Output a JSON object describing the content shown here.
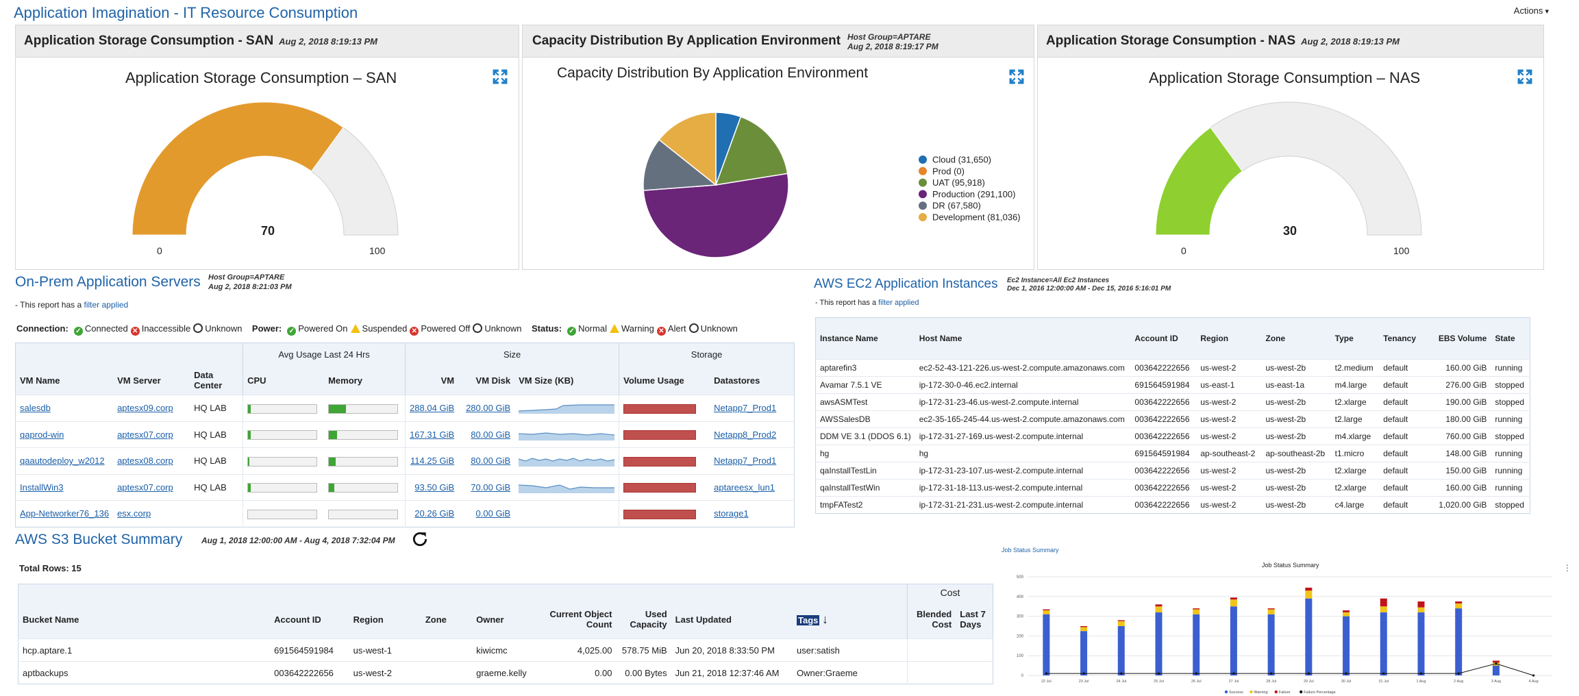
{
  "app": {
    "title": "Application Imagination - IT Resource Consumption",
    "actions_label": "Actions"
  },
  "panels": {
    "san": {
      "header": "Application Storage Consumption - SAN",
      "date": "Aug 2, 2018 8:19:13 PM",
      "chart_title": "Application Storage Consumption – SAN",
      "value": "70",
      "min": "0",
      "max": "100"
    },
    "cap": {
      "header": "Capacity Distribution By Application Environment",
      "meta1": "Host Group=APTARE",
      "meta2": "Aug 2, 2018 8:19:17 PM",
      "chart_title": "Capacity Distribution By Application Environment"
    },
    "nas": {
      "header": "Application Storage Consumption - NAS",
      "date": "Aug 2, 2018 8:19:13 PM",
      "chart_title": "Application Storage Consumption – NAS",
      "value": "30",
      "min": "0",
      "max": "100"
    }
  },
  "chart_data": [
    {
      "type": "gauge",
      "title": "Application Storage Consumption – SAN",
      "value": 70,
      "min": 0,
      "max": 100,
      "color": "#e39a2d"
    },
    {
      "type": "pie",
      "title": "Capacity Distribution By Application Environment",
      "categories": [
        "Cloud",
        "Prod",
        "UAT",
        "Production",
        "DR",
        "Development"
      ],
      "values": [
        31650,
        0,
        95918,
        291100,
        67580,
        81036
      ],
      "colors": [
        "#1f6fb2",
        "#e8852a",
        "#6b8e3a",
        "#6a2478",
        "#65707f",
        "#e6ad45"
      ],
      "legend_labels": [
        "Cloud (31,650)",
        "Prod (0)",
        "UAT (95,918)",
        "Production (291,100)",
        "DR (67,580)",
        "Development (81,036)"
      ],
      "legend": "right"
    },
    {
      "type": "gauge",
      "title": "Application Storage Consumption – NAS",
      "value": 30,
      "min": 0,
      "max": 100,
      "color": "#8fcf2f"
    },
    {
      "type": "bar",
      "title": "Job Status Summary",
      "categories": [
        "22 Jul",
        "23 Jul",
        "24 Jul",
        "25 Jul",
        "26 Jul",
        "27 Jul",
        "28 Jul",
        "29 Jul",
        "30 Jul",
        "31 Jul",
        "1 Aug",
        "2 Aug",
        "3 Aug",
        "4 Aug"
      ],
      "series": [
        {
          "name": "Success",
          "values": [
            310,
            225,
            250,
            320,
            310,
            350,
            310,
            390,
            300,
            320,
            320,
            340,
            50,
            0
          ]
        },
        {
          "name": "Warning",
          "values": [
            20,
            20,
            25,
            30,
            25,
            35,
            25,
            40,
            20,
            30,
            25,
            25,
            15,
            0
          ]
        },
        {
          "name": "Failure",
          "values": [
            5,
            5,
            5,
            10,
            5,
            10,
            5,
            15,
            10,
            40,
            30,
            10,
            10,
            0
          ]
        },
        {
          "name": "Failure Percentage",
          "values": [
            2,
            2,
            2,
            2,
            2,
            2,
            2,
            2,
            2,
            2,
            2,
            2,
            12,
            0
          ]
        }
      ],
      "colors": [
        "#3b5fd0",
        "#f0c419",
        "#c0141c",
        "#111111"
      ],
      "ylim": [
        0,
        500
      ],
      "legend": "bottom"
    }
  ],
  "onprem": {
    "title": "On-Prem Application Servers",
    "meta1": "Host Group=APTARE",
    "meta2": "Aug 2, 2018 8:21:03 PM",
    "note_prefix": "- This report has a ",
    "note_link": "filter applied",
    "legend": {
      "connection_label": "Connection:",
      "connected": "Connected",
      "inaccessible": "Inaccessible",
      "unknown": "Unknown",
      "power_label": "Power:",
      "powered_on": "Powered On",
      "suspended": "Suspended",
      "powered_off": "Powered Off",
      "unknown2": "Unknown",
      "status_label": "Status:",
      "normal": "Normal",
      "warning": "Warning",
      "alert": "Alert",
      "unknown3": "Unknown"
    },
    "groups": {
      "avg": "Avg Usage Last 24 Hrs",
      "size": "Size",
      "storage": "Storage"
    },
    "columns": {
      "vm_name": "VM Name",
      "vm_server": "VM Server",
      "dc": "Data Center",
      "cpu": "CPU",
      "mem": "Memory",
      "vm": "VM",
      "vm_disk": "VM Disk",
      "vm_size": "VM Size (KB)",
      "vol": "Volume Usage",
      "ds": "Datastores"
    },
    "rows": [
      {
        "vm_name": "salesdb",
        "server": "aptesx09.corp",
        "dc": "HQ LAB",
        "cpu": 4,
        "mem": 25,
        "vm": "288.04 GiB",
        "disk": "280.00 GiB",
        "ds": "Netapp7_Prod1"
      },
      {
        "vm_name": "qaprod-win",
        "server": "aptesx07.corp",
        "dc": "HQ LAB",
        "cpu": 4,
        "mem": 12,
        "vm": "167.31 GiB",
        "disk": "80.00 GiB",
        "ds": "Netapp8_Prod2"
      },
      {
        "vm_name": "qaautodeploy_w2012",
        "server": "aptesx08.corp",
        "dc": "HQ LAB",
        "cpu": 2,
        "mem": 10,
        "vm": "114.25 GiB",
        "disk": "80.00 GiB",
        "ds": "Netapp7_Prod1"
      },
      {
        "vm_name": "InstallWin3",
        "server": "aptesx07.corp",
        "dc": "HQ LAB",
        "cpu": 4,
        "mem": 8,
        "vm": "93.50 GiB",
        "disk": "70.00 GiB",
        "ds": "aptareesx_lun1"
      },
      {
        "vm_name": "App-Networker76_136",
        "server": "esx.corp",
        "dc": "",
        "cpu": 0,
        "mem": 0,
        "vm": "20.26 GiB",
        "disk": "0.00 GiB",
        "ds": "storage1"
      }
    ]
  },
  "ec2": {
    "title": "AWS EC2 Application Instances",
    "meta1": "Ec2 Instance=All Ec2 Instances",
    "meta2": "Dec 1, 2016 12:00:00 AM - Dec 15, 2016 5:16:01 PM",
    "note_prefix": "- This report has a ",
    "note_link": "filter applied",
    "columns": [
      "Instance Name",
      "Host Name",
      "Account ID",
      "Region",
      "Zone",
      "Type",
      "Tenancy",
      "EBS Volume",
      "State"
    ],
    "rows": [
      [
        "aptarefin3",
        "ec2-52-43-121-226.us-west-2.compute.amazonaws.com",
        "003642222656",
        "us-west-2",
        "us-west-2b",
        "t2.medium",
        "default",
        "160.00 GiB",
        "running"
      ],
      [
        "Avamar 7.5.1 VE",
        "ip-172-30-0-46.ec2.internal",
        "691564591984",
        "us-east-1",
        "us-east-1a",
        "m4.large",
        "default",
        "276.00 GiB",
        "stopped"
      ],
      [
        "awsASMTest",
        "ip-172-31-23-46.us-west-2.compute.internal",
        "003642222656",
        "us-west-2",
        "us-west-2b",
        "t2.xlarge",
        "default",
        "190.00 GiB",
        "stopped"
      ],
      [
        "AWSSalesDB",
        "ec2-35-165-245-44.us-west-2.compute.amazonaws.com",
        "003642222656",
        "us-west-2",
        "us-west-2b",
        "t2.large",
        "default",
        "180.00 GiB",
        "running"
      ],
      [
        "DDM VE 3.1 (DDOS 6.1)",
        "ip-172-31-27-169.us-west-2.compute.internal",
        "003642222656",
        "us-west-2",
        "us-west-2b",
        "m4.xlarge",
        "default",
        "760.00 GiB",
        "stopped"
      ],
      [
        "hg",
        "hg",
        "691564591984",
        "ap-southeast-2",
        "ap-southeast-2b",
        "t1.micro",
        "default",
        "148.00 GiB",
        "running"
      ],
      [
        "qaInstallTestLin",
        "ip-172-31-23-107.us-west-2.compute.internal",
        "003642222656",
        "us-west-2",
        "us-west-2b",
        "t2.xlarge",
        "default",
        "150.00 GiB",
        "running"
      ],
      [
        "qaInstallTestWin",
        "ip-172-31-18-113.us-west-2.compute.internal",
        "003642222656",
        "us-west-2",
        "us-west-2b",
        "t2.xlarge",
        "default",
        "160.00 GiB",
        "running"
      ],
      [
        "tmpFATest2",
        "ip-172-31-21-231.us-west-2.compute.internal",
        "003642222656",
        "us-west-2",
        "us-west-2b",
        "c4.large",
        "default",
        "1,020.00 GiB",
        "stopped"
      ]
    ]
  },
  "s3": {
    "title": "AWS S3 Bucket Summary",
    "date": "Aug 1, 2018 12:00:00 AM - Aug 4, 2018 7:32:04 PM",
    "total_rows": "Total Rows: 15",
    "cost_group": "Cost",
    "columns": {
      "bucket": "Bucket Name",
      "account": "Account ID",
      "region": "Region",
      "zone": "Zone",
      "owner": "Owner",
      "count": "Current Object Count",
      "used": "Used Capacity",
      "updated": "Last Updated",
      "tags": "Tags",
      "blended": "Blended Cost",
      "last7": "Last 7 Days"
    },
    "rows": [
      {
        "bucket": "hcp.aptare.1",
        "account": "691564591984",
        "region": "us-west-1",
        "zone": "",
        "owner": "kiwicmc",
        "count": "4,025.00",
        "used": "578.75 MiB",
        "updated": "Jun 20, 2018 8:33:50 PM",
        "tags": "user:satish"
      },
      {
        "bucket": "aptbackups",
        "account": "003642222656",
        "region": "us-west-2",
        "zone": "",
        "owner": "graeme.kelly",
        "count": "0.00",
        "used": "0.00 Bytes",
        "updated": "Jun 21, 2018 12:37:46 AM",
        "tags": "Owner:Graeme"
      }
    ]
  },
  "jobs": {
    "title": "Job Status Summary",
    "chart_title": "Job Status Summary"
  }
}
